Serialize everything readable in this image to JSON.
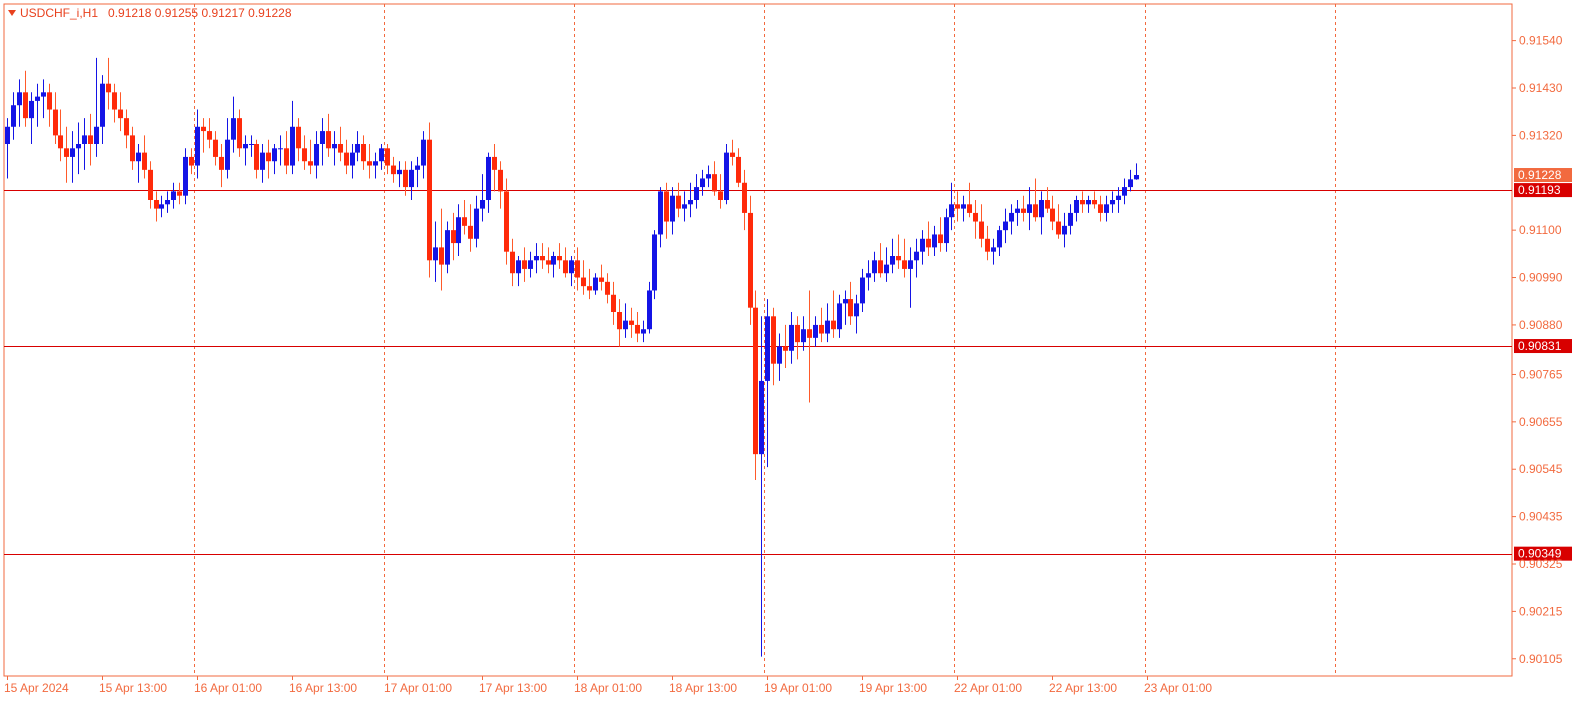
{
  "header": {
    "symbol": "USDCHF_i,H1",
    "ohlc": "0.91218 0.91255 0.91217 0.91228"
  },
  "colors": {
    "frame": "#f26a3f",
    "grid": "#f26a3f",
    "level_line": "#d80000",
    "bull": "#1414e6",
    "bear": "#ff2a0a",
    "wick_bear": "#ff5a2a",
    "label_text": "#f26a3f",
    "current_price_box": "#f26a3f",
    "level_box": "#d80000"
  },
  "chart_data": {
    "type": "candlestick",
    "symbol": "USDCHF_i",
    "timeframe": "H1",
    "ylim": [
      0.90065,
      0.91625
    ],
    "y_ticks": [
      "0.91540",
      "0.91430",
      "0.91320",
      "0.91228",
      "0.91193",
      "0.91100",
      "0.90990",
      "0.90880",
      "0.90831",
      "0.90765",
      "0.90655",
      "0.90545",
      "0.90435",
      "0.90349",
      "0.90325",
      "0.90215",
      "0.90105"
    ],
    "x_tick_labels": [
      {
        "label": "15 Apr 2024",
        "bar": 0
      },
      {
        "label": "15 Apr 13:00",
        "bar": 16
      },
      {
        "label": "16 Apr 01:00",
        "bar": 32
      },
      {
        "label": "16 Apr 13:00",
        "bar": 48
      },
      {
        "label": "17 Apr 01:00",
        "bar": 64
      },
      {
        "label": "17 Apr 13:00",
        "bar": 80
      },
      {
        "label": "18 Apr 01:00",
        "bar": 96
      },
      {
        "label": "18 Apr 13:00",
        "bar": 112
      },
      {
        "label": "19 Apr 01:00",
        "bar": 128
      },
      {
        "label": "19 Apr 13:00",
        "bar": 144
      },
      {
        "label": "22 Apr 01:00",
        "bar": 160
      },
      {
        "label": "22 Apr 13:00",
        "bar": 176
      },
      {
        "label": "23 Apr 01:00",
        "bar": 192
      }
    ],
    "period_separator_bars": [
      31,
      63,
      95,
      127,
      159,
      191,
      223
    ],
    "horizontal_levels": [
      {
        "price": "0.91193"
      },
      {
        "price": "0.90831"
      },
      {
        "price": "0.90349"
      }
    ],
    "current_price": "0.91228",
    "grid": false,
    "ohlc": [
      [
        0.913,
        0.9136,
        0.9122,
        0.9134
      ],
      [
        0.9134,
        0.9142,
        0.9131,
        0.9139
      ],
      [
        0.9139,
        0.9145,
        0.9134,
        0.9142
      ],
      [
        0.9142,
        0.9147,
        0.9134,
        0.9136
      ],
      [
        0.9136,
        0.9142,
        0.913,
        0.914
      ],
      [
        0.914,
        0.9144,
        0.9134,
        0.9141
      ],
      [
        0.9141,
        0.9145,
        0.9136,
        0.9142
      ],
      [
        0.9142,
        0.9144,
        0.9134,
        0.9138
      ],
      [
        0.9138,
        0.9142,
        0.913,
        0.9132
      ],
      [
        0.9132,
        0.9138,
        0.9126,
        0.9129
      ],
      [
        0.9129,
        0.9134,
        0.9121,
        0.9127
      ],
      [
        0.9127,
        0.9133,
        0.9121,
        0.9129
      ],
      [
        0.9129,
        0.9135,
        0.9123,
        0.913
      ],
      [
        0.913,
        0.9136,
        0.9124,
        0.9132
      ],
      [
        0.9132,
        0.9137,
        0.9125,
        0.913
      ],
      [
        0.913,
        0.915,
        0.9127,
        0.9134
      ],
      [
        0.9134,
        0.9146,
        0.913,
        0.9144
      ],
      [
        0.9144,
        0.915,
        0.9138,
        0.9142
      ],
      [
        0.9142,
        0.9144,
        0.9135,
        0.9138
      ],
      [
        0.9138,
        0.9142,
        0.9133,
        0.9136
      ],
      [
        0.9136,
        0.9138,
        0.9129,
        0.9132
      ],
      [
        0.9132,
        0.9134,
        0.9124,
        0.9126
      ],
      [
        0.9126,
        0.913,
        0.9121,
        0.9128
      ],
      [
        0.9128,
        0.9132,
        0.9122,
        0.9124
      ],
      [
        0.9124,
        0.9126,
        0.9115,
        0.9117
      ],
      [
        0.9117,
        0.9119,
        0.9112,
        0.9115
      ],
      [
        0.9115,
        0.9118,
        0.9113,
        0.9116
      ],
      [
        0.9116,
        0.9119,
        0.9114,
        0.9117
      ],
      [
        0.9117,
        0.9121,
        0.9115,
        0.9119
      ],
      [
        0.9119,
        0.9121,
        0.9116,
        0.9118
      ],
      [
        0.9118,
        0.9129,
        0.9116,
        0.9127
      ],
      [
        0.9127,
        0.9129,
        0.9123,
        0.9125
      ],
      [
        0.9125,
        0.9138,
        0.9122,
        0.9134
      ],
      [
        0.9134,
        0.9136,
        0.9128,
        0.9133
      ],
      [
        0.9133,
        0.9136,
        0.9129,
        0.9131
      ],
      [
        0.9131,
        0.9133,
        0.9125,
        0.9127
      ],
      [
        0.9127,
        0.913,
        0.912,
        0.9124
      ],
      [
        0.9124,
        0.9136,
        0.9122,
        0.9131
      ],
      [
        0.9131,
        0.9141,
        0.9128,
        0.9136
      ],
      [
        0.9136,
        0.9138,
        0.9127,
        0.9129
      ],
      [
        0.9129,
        0.9132,
        0.9125,
        0.913
      ],
      [
        0.913,
        0.9132,
        0.9127,
        0.913
      ],
      [
        0.913,
        0.9131,
        0.9122,
        0.9124
      ],
      [
        0.9124,
        0.913,
        0.9121,
        0.9128
      ],
      [
        0.9128,
        0.9131,
        0.9122,
        0.9126
      ],
      [
        0.9126,
        0.913,
        0.9123,
        0.9129
      ],
      [
        0.9129,
        0.9132,
        0.9125,
        0.9129
      ],
      [
        0.9129,
        0.9133,
        0.9123,
        0.9125
      ],
      [
        0.9125,
        0.914,
        0.9123,
        0.9134
      ],
      [
        0.9134,
        0.9136,
        0.9126,
        0.9129
      ],
      [
        0.9129,
        0.9132,
        0.9124,
        0.9126
      ],
      [
        0.9126,
        0.9131,
        0.9123,
        0.9125
      ],
      [
        0.9125,
        0.9133,
        0.9122,
        0.913
      ],
      [
        0.913,
        0.9136,
        0.9125,
        0.9133
      ],
      [
        0.9133,
        0.9137,
        0.9127,
        0.9129
      ],
      [
        0.9129,
        0.9133,
        0.9125,
        0.913
      ],
      [
        0.913,
        0.9134,
        0.9126,
        0.9128
      ],
      [
        0.9128,
        0.9131,
        0.9123,
        0.9125
      ],
      [
        0.9125,
        0.913,
        0.9122,
        0.9128
      ],
      [
        0.9128,
        0.9133,
        0.9126,
        0.913
      ],
      [
        0.913,
        0.9132,
        0.9124,
        0.9126
      ],
      [
        0.9126,
        0.913,
        0.9122,
        0.9125
      ],
      [
        0.9125,
        0.9128,
        0.9122,
        0.9126
      ],
      [
        0.9126,
        0.913,
        0.9124,
        0.9129
      ],
      [
        0.9129,
        0.913,
        0.9123,
        0.9125
      ],
      [
        0.9125,
        0.9127,
        0.9121,
        0.9123
      ],
      [
        0.9123,
        0.9126,
        0.912,
        0.9124
      ],
      [
        0.9124,
        0.9126,
        0.9118,
        0.912
      ],
      [
        0.912,
        0.9126,
        0.9117,
        0.9124
      ],
      [
        0.9124,
        0.9127,
        0.912,
        0.9125
      ],
      [
        0.9125,
        0.9133,
        0.9122,
        0.9131
      ],
      [
        0.9131,
        0.9135,
        0.9099,
        0.9103
      ],
      [
        0.9103,
        0.9112,
        0.9098,
        0.9106
      ],
      [
        0.9106,
        0.9115,
        0.9096,
        0.9102
      ],
      [
        0.9102,
        0.9112,
        0.91,
        0.911
      ],
      [
        0.911,
        0.9114,
        0.9103,
        0.9107
      ],
      [
        0.9107,
        0.9116,
        0.9104,
        0.9113
      ],
      [
        0.9113,
        0.9117,
        0.9109,
        0.9111
      ],
      [
        0.9111,
        0.9116,
        0.9105,
        0.9108
      ],
      [
        0.9108,
        0.9118,
        0.9106,
        0.9115
      ],
      [
        0.9115,
        0.9123,
        0.9112,
        0.9117
      ],
      [
        0.9117,
        0.9128,
        0.9114,
        0.9127
      ],
      [
        0.9127,
        0.913,
        0.9119,
        0.9124
      ],
      [
        0.9124,
        0.9126,
        0.9115,
        0.9119
      ],
      [
        0.9119,
        0.9122,
        0.9102,
        0.9105
      ],
      [
        0.9105,
        0.9108,
        0.9097,
        0.91
      ],
      [
        0.91,
        0.9104,
        0.9097,
        0.9103
      ],
      [
        0.9103,
        0.9106,
        0.9098,
        0.9101
      ],
      [
        0.9101,
        0.9105,
        0.9099,
        0.9103
      ],
      [
        0.9103,
        0.9107,
        0.91,
        0.9104
      ],
      [
        0.9104,
        0.9107,
        0.9101,
        0.9103
      ],
      [
        0.9103,
        0.9106,
        0.91,
        0.9102
      ],
      [
        0.9102,
        0.9105,
        0.9099,
        0.9104
      ],
      [
        0.9104,
        0.9107,
        0.9101,
        0.9103
      ],
      [
        0.9103,
        0.9106,
        0.9099,
        0.91
      ],
      [
        0.91,
        0.9104,
        0.9097,
        0.9103
      ],
      [
        0.9103,
        0.9106,
        0.9096,
        0.9099
      ],
      [
        0.9099,
        0.9103,
        0.9095,
        0.9097
      ],
      [
        0.9097,
        0.9101,
        0.9094,
        0.9096
      ],
      [
        0.9096,
        0.91,
        0.9095,
        0.9099
      ],
      [
        0.9099,
        0.9102,
        0.9096,
        0.9098
      ],
      [
        0.9098,
        0.91,
        0.9093,
        0.9095
      ],
      [
        0.9095,
        0.9098,
        0.9088,
        0.9091
      ],
      [
        0.9091,
        0.9094,
        0.9083,
        0.9087
      ],
      [
        0.9087,
        0.9093,
        0.9085,
        0.9089
      ],
      [
        0.9089,
        0.9092,
        0.9085,
        0.9088
      ],
      [
        0.9088,
        0.9091,
        0.9084,
        0.9086
      ],
      [
        0.9086,
        0.9089,
        0.9084,
        0.9087
      ],
      [
        0.9087,
        0.9098,
        0.9086,
        0.9096
      ],
      [
        0.9096,
        0.911,
        0.9094,
        0.9109
      ],
      [
        0.9109,
        0.912,
        0.9106,
        0.9119
      ],
      [
        0.9119,
        0.9121,
        0.9108,
        0.9112
      ],
      [
        0.9112,
        0.912,
        0.9109,
        0.9118
      ],
      [
        0.9118,
        0.9121,
        0.9113,
        0.9115
      ],
      [
        0.9115,
        0.9119,
        0.9112,
        0.9116
      ],
      [
        0.9116,
        0.9121,
        0.9113,
        0.9117
      ],
      [
        0.9117,
        0.9123,
        0.9115,
        0.912
      ],
      [
        0.912,
        0.9124,
        0.9118,
        0.9122
      ],
      [
        0.9122,
        0.9125,
        0.912,
        0.9123
      ],
      [
        0.9123,
        0.9126,
        0.9118,
        0.9119
      ],
      [
        0.9119,
        0.9123,
        0.9115,
        0.9117
      ],
      [
        0.9117,
        0.913,
        0.9116,
        0.9128
      ],
      [
        0.9128,
        0.9131,
        0.9125,
        0.9127
      ],
      [
        0.9127,
        0.9129,
        0.912,
        0.9121
      ],
      [
        0.9121,
        0.9124,
        0.911,
        0.9114
      ],
      [
        0.9114,
        0.9118,
        0.9088,
        0.9092
      ],
      [
        0.9092,
        0.9096,
        0.9052,
        0.9058
      ],
      [
        0.9058,
        0.909,
        0.9011,
        0.9075
      ],
      [
        0.9075,
        0.9094,
        0.9055,
        0.909
      ],
      [
        0.909,
        0.9092,
        0.9074,
        0.9079
      ],
      [
        0.9079,
        0.9086,
        0.9075,
        0.9083
      ],
      [
        0.9083,
        0.9088,
        0.9078,
        0.9082
      ],
      [
        0.9082,
        0.9091,
        0.9079,
        0.9088
      ],
      [
        0.9088,
        0.909,
        0.908,
        0.9084
      ],
      [
        0.9084,
        0.909,
        0.9082,
        0.9087
      ],
      [
        0.9087,
        0.9096,
        0.907,
        0.9085
      ],
      [
        0.9085,
        0.909,
        0.9083,
        0.9088
      ],
      [
        0.9088,
        0.9092,
        0.9084,
        0.9086
      ],
      [
        0.9086,
        0.9093,
        0.9084,
        0.9089
      ],
      [
        0.9089,
        0.9096,
        0.9085,
        0.9087
      ],
      [
        0.9087,
        0.9095,
        0.9085,
        0.9093
      ],
      [
        0.9093,
        0.9096,
        0.9088,
        0.9094
      ],
      [
        0.9094,
        0.9098,
        0.9088,
        0.909
      ],
      [
        0.909,
        0.9095,
        0.9086,
        0.9093
      ],
      [
        0.9093,
        0.9101,
        0.9091,
        0.9099
      ],
      [
        0.9099,
        0.9103,
        0.9096,
        0.91
      ],
      [
        0.91,
        0.9105,
        0.9098,
        0.9103
      ],
      [
        0.9103,
        0.9107,
        0.9099,
        0.91
      ],
      [
        0.91,
        0.9106,
        0.9098,
        0.9102
      ],
      [
        0.9102,
        0.9108,
        0.91,
        0.9104
      ],
      [
        0.9104,
        0.9109,
        0.9101,
        0.9103
      ],
      [
        0.9103,
        0.9108,
        0.9099,
        0.9101
      ],
      [
        0.9101,
        0.9106,
        0.9092,
        0.9103
      ],
      [
        0.9103,
        0.9108,
        0.9099,
        0.9105
      ],
      [
        0.9105,
        0.911,
        0.9102,
        0.9108
      ],
      [
        0.9108,
        0.9112,
        0.9104,
        0.9106
      ],
      [
        0.9106,
        0.9111,
        0.9104,
        0.9109
      ],
      [
        0.9109,
        0.9113,
        0.9105,
        0.9107
      ],
      [
        0.9107,
        0.9115,
        0.9105,
        0.9113
      ],
      [
        0.9113,
        0.9121,
        0.911,
        0.9116
      ],
      [
        0.9116,
        0.9119,
        0.9112,
        0.9115
      ],
      [
        0.9115,
        0.9118,
        0.9112,
        0.9116
      ],
      [
        0.9116,
        0.9121,
        0.9113,
        0.9114
      ],
      [
        0.9114,
        0.9117,
        0.9108,
        0.9112
      ],
      [
        0.9112,
        0.9116,
        0.9106,
        0.9108
      ],
      [
        0.9108,
        0.9111,
        0.9103,
        0.9105
      ],
      [
        0.9105,
        0.9108,
        0.9102,
        0.9106
      ],
      [
        0.9106,
        0.9111,
        0.9104,
        0.911
      ],
      [
        0.911,
        0.9115,
        0.9107,
        0.9112
      ],
      [
        0.9112,
        0.9116,
        0.9109,
        0.9114
      ],
      [
        0.9114,
        0.9117,
        0.9111,
        0.9115
      ],
      [
        0.9115,
        0.9118,
        0.9112,
        0.9114
      ],
      [
        0.9114,
        0.912,
        0.911,
        0.9116
      ],
      [
        0.9116,
        0.9122,
        0.9112,
        0.9113
      ],
      [
        0.9113,
        0.9119,
        0.9109,
        0.9117
      ],
      [
        0.9117,
        0.912,
        0.9114,
        0.9115
      ],
      [
        0.9115,
        0.9118,
        0.911,
        0.9112
      ],
      [
        0.9112,
        0.9116,
        0.9108,
        0.9109
      ],
      [
        0.9109,
        0.9114,
        0.9106,
        0.9111
      ],
      [
        0.9111,
        0.9116,
        0.9109,
        0.9114
      ],
      [
        0.9114,
        0.9118,
        0.9112,
        0.9117
      ],
      [
        0.9117,
        0.9119,
        0.9114,
        0.9116
      ],
      [
        0.9116,
        0.9118,
        0.9114,
        0.9117
      ],
      [
        0.9117,
        0.9119,
        0.9115,
        0.9116
      ],
      [
        0.9116,
        0.9118,
        0.9112,
        0.9114
      ],
      [
        0.9114,
        0.9118,
        0.9112,
        0.9116
      ],
      [
        0.9116,
        0.9119,
        0.9114,
        0.9117
      ],
      [
        0.9117,
        0.912,
        0.9114,
        0.9118
      ],
      [
        0.9118,
        0.9122,
        0.9116,
        0.912
      ],
      [
        0.912,
        0.9124,
        0.9119,
        0.91218
      ],
      [
        0.91218,
        0.91255,
        0.91217,
        0.91228
      ]
    ]
  }
}
